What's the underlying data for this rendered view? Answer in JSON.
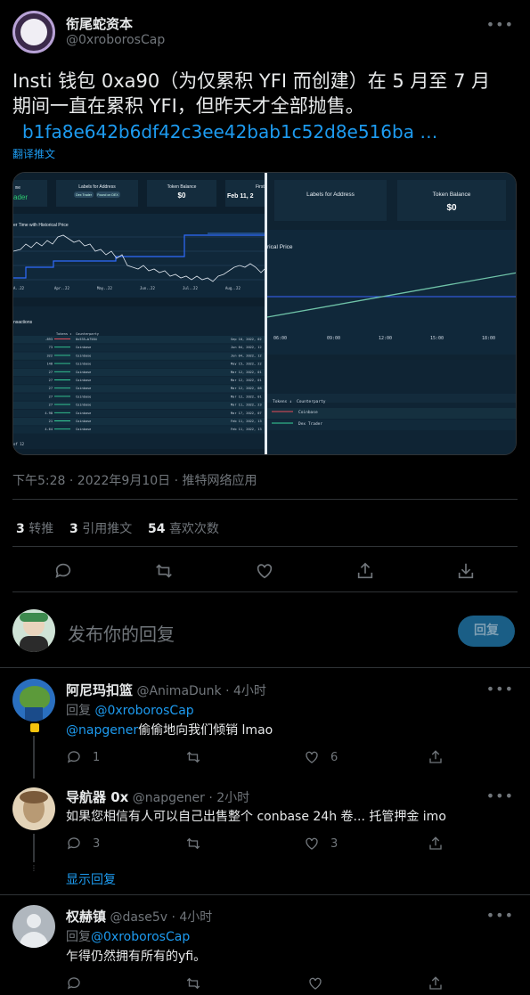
{
  "tweet": {
    "author_name": "衔尾蛇资本",
    "author_handle": "@0xroborosCap",
    "text_line1": "Insti 钱包 0xa90（为仅累积 YFI 而创建）在 5 月至 7 月",
    "text_line2": "期间一直在累积 YFI，但昨天才全部抛售。",
    "link": "b1fa8e642b6df42c3ee42bab1c52d8e516ba …",
    "translate": "翻译推文",
    "timestamp": "下午5:28 · 2022年9月10日 · 推特网络应用",
    "retweets_count": "3",
    "retweets_label": "转推",
    "quotes_count": "3",
    "quotes_label": "引用推文",
    "likes_count": "54",
    "likes_label": "喜欢次数"
  },
  "screenshot": {
    "left": {
      "card1_title": "Labels for Address",
      "card1_tag1": "Dex Trader",
      "card1_tag2": "Found on DEX",
      "card2_title": "Token Balance",
      "card2_value": "$0",
      "card3_title": "First",
      "card3_value": "Feb 11, 2",
      "name_frag": "me",
      "label_frag": "ader",
      "chart_title": "er Time with Historical Price",
      "x_ticks": [
        "A..22",
        "Apr..22",
        "May..22",
        "Jun..22",
        "Jul..22",
        "Aug..22"
      ],
      "section": "nsactions",
      "col_tokens": "Tokens ↕",
      "col_counterparty": "Counterparty",
      "rows": [
        {
          "amt": "-893",
          "cp": "0x535…b7584",
          "time": "Sep 10, 2022, 02"
        },
        {
          "amt": "73",
          "cp": "Coinbase",
          "time": "Jun 04, 2022, 12"
        },
        {
          "amt": "322",
          "cp": "Coinbase",
          "time": "Jun 04, 2022, 12"
        },
        {
          "amt": "148",
          "cp": "Coinbase",
          "time": "May 15, 2022, 22"
        },
        {
          "amt": "27",
          "cp": "Coinbase",
          "time": "Mar 12, 2022, 01"
        },
        {
          "amt": "27",
          "cp": "Coinbase",
          "time": "Mar 12, 2022, 01"
        },
        {
          "amt": "27",
          "cp": "Coinbase",
          "time": "Mar 12, 2022, 08"
        },
        {
          "amt": "27",
          "cp": "Coinbase",
          "time": "Mar 12, 2022, 01"
        },
        {
          "amt": "27",
          "cp": "Coinbase",
          "time": "Mar 11, 2022, 23"
        },
        {
          "amt": "4.98",
          "cp": "Coinbase",
          "time": "Mar 17, 2022, 07"
        },
        {
          "amt": "21",
          "cp": "Coinbase",
          "time": "Feb 11, 2022, 13"
        },
        {
          "amt": "4.64",
          "cp": "Coinbase",
          "time": "Feb 11, 2022, 13"
        }
      ],
      "footer": "of 12"
    },
    "right": {
      "card1_title": "Labels for Address",
      "card2_title": "Token Balance",
      "card2_value": "$0",
      "chart_title": "rical Price",
      "x_ticks": [
        "06:00",
        "09:00",
        "12:00",
        "15:00",
        "18:00"
      ],
      "col_tokens": "Tokens ↕",
      "col_counterparty": "Counterparty",
      "row1_cp": "Coinbase",
      "row2_cp": "Dex Trader"
    }
  },
  "reply_box": {
    "placeholder": "发布你的回复",
    "button": "回复"
  },
  "replies": [
    {
      "name": "阿尼玛扣篮",
      "handle": "@AnimaDunk",
      "time": "· 4小时",
      "reply_to_prefix": "回复",
      "reply_to": "@0xroborosCap",
      "mention": "@napgener",
      "text": "偷偷地向我们倾销 lmao",
      "replies": "1",
      "likes": "6"
    },
    {
      "name": "导航器 0x",
      "handle": "@napgener",
      "time": "· 2小时",
      "text": "如果您相信有人可以自己出售整个 conbase 24h 卷... 托管押金 imo",
      "replies": "3",
      "likes": "3",
      "show_replies": "显示回复"
    },
    {
      "name": "权赫镇",
      "handle": "@dase5v",
      "time": "· 4小时",
      "reply_to_prefix": "回复",
      "reply_to": "@0xroborosCap",
      "text": "乍得仍然拥有所有的yfi。"
    }
  ]
}
